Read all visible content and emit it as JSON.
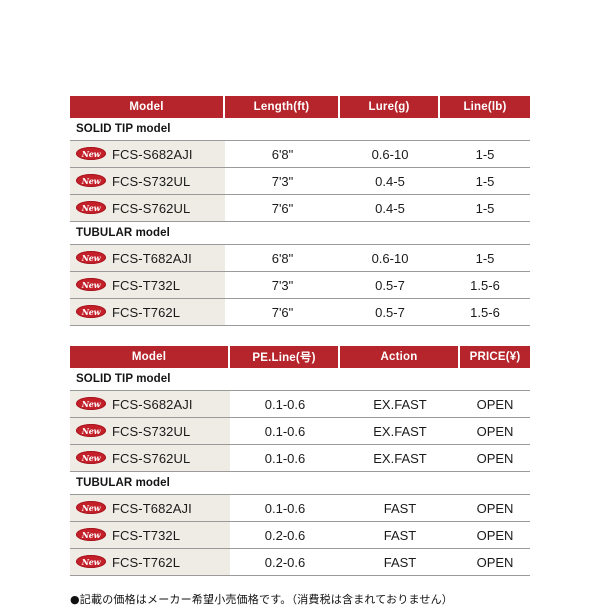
{
  "tables": [
    {
      "id": "dimensions-table",
      "columns": [
        "Model",
        "Length(ft)",
        "Lure(g)",
        "Line(lb)"
      ],
      "sections": [
        {
          "title": "SOLID TIP model",
          "rows": [
            {
              "badge": "New",
              "model": "FCS-S682AJI",
              "values": [
                "6'8\"",
                "0.6-10",
                "1-5"
              ]
            },
            {
              "badge": "New",
              "model": "FCS-S732UL",
              "values": [
                "7'3\"",
                "0.4-5",
                "1-5"
              ]
            },
            {
              "badge": "New",
              "model": "FCS-S762UL",
              "values": [
                "7'6\"",
                "0.4-5",
                "1-5"
              ]
            }
          ]
        },
        {
          "title": "TUBULAR model",
          "rows": [
            {
              "badge": "New",
              "model": "FCS-T682AJI",
              "values": [
                "6'8\"",
                "0.6-10",
                "1-5"
              ]
            },
            {
              "badge": "New",
              "model": "FCS-T732L",
              "values": [
                "7'3\"",
                "0.5-7",
                "1.5-6"
              ]
            },
            {
              "badge": "New",
              "model": "FCS-T762L",
              "values": [
                "7'6\"",
                "0.5-7",
                "1.5-6"
              ]
            }
          ]
        }
      ]
    },
    {
      "id": "line-action-price-table",
      "columns": [
        "Model",
        "PE.Line(号)",
        "Action",
        "PRICE(¥)"
      ],
      "sections": [
        {
          "title": "SOLID TIP model",
          "rows": [
            {
              "badge": "New",
              "model": "FCS-S682AJI",
              "values": [
                "0.1-0.6",
                "EX.FAST",
                "OPEN"
              ]
            },
            {
              "badge": "New",
              "model": "FCS-S732UL",
              "values": [
                "0.1-0.6",
                "EX.FAST",
                "OPEN"
              ]
            },
            {
              "badge": "New",
              "model": "FCS-S762UL",
              "values": [
                "0.1-0.6",
                "EX.FAST",
                "OPEN"
              ]
            }
          ]
        },
        {
          "title": "TUBULAR model",
          "rows": [
            {
              "badge": "New",
              "model": "FCS-T682AJI",
              "values": [
                "0.1-0.6",
                "FAST",
                "OPEN"
              ]
            },
            {
              "badge": "New",
              "model": "FCS-T732L",
              "values": [
                "0.2-0.6",
                "FAST",
                "OPEN"
              ]
            },
            {
              "badge": "New",
              "model": "FCS-T762L",
              "values": [
                "0.2-0.6",
                "FAST",
                "OPEN"
              ]
            }
          ]
        }
      ]
    }
  ],
  "footnote": "●記載の価格はメーカー希望小売価格です。（消費税は含まれておりません）",
  "colors": {
    "header_red": "#b5252b",
    "badge_red": "#c3202a",
    "model_cell_bg": "#eeece4",
    "rule": "#9a9a9a",
    "page_bg": "#ffffff"
  },
  "column_widths": {
    "dimensions-table": [
      "155px",
      "115px",
      "100px",
      "90px"
    ],
    "line-action-price-table": [
      "160px",
      "110px",
      "120px",
      "70px"
    ]
  }
}
